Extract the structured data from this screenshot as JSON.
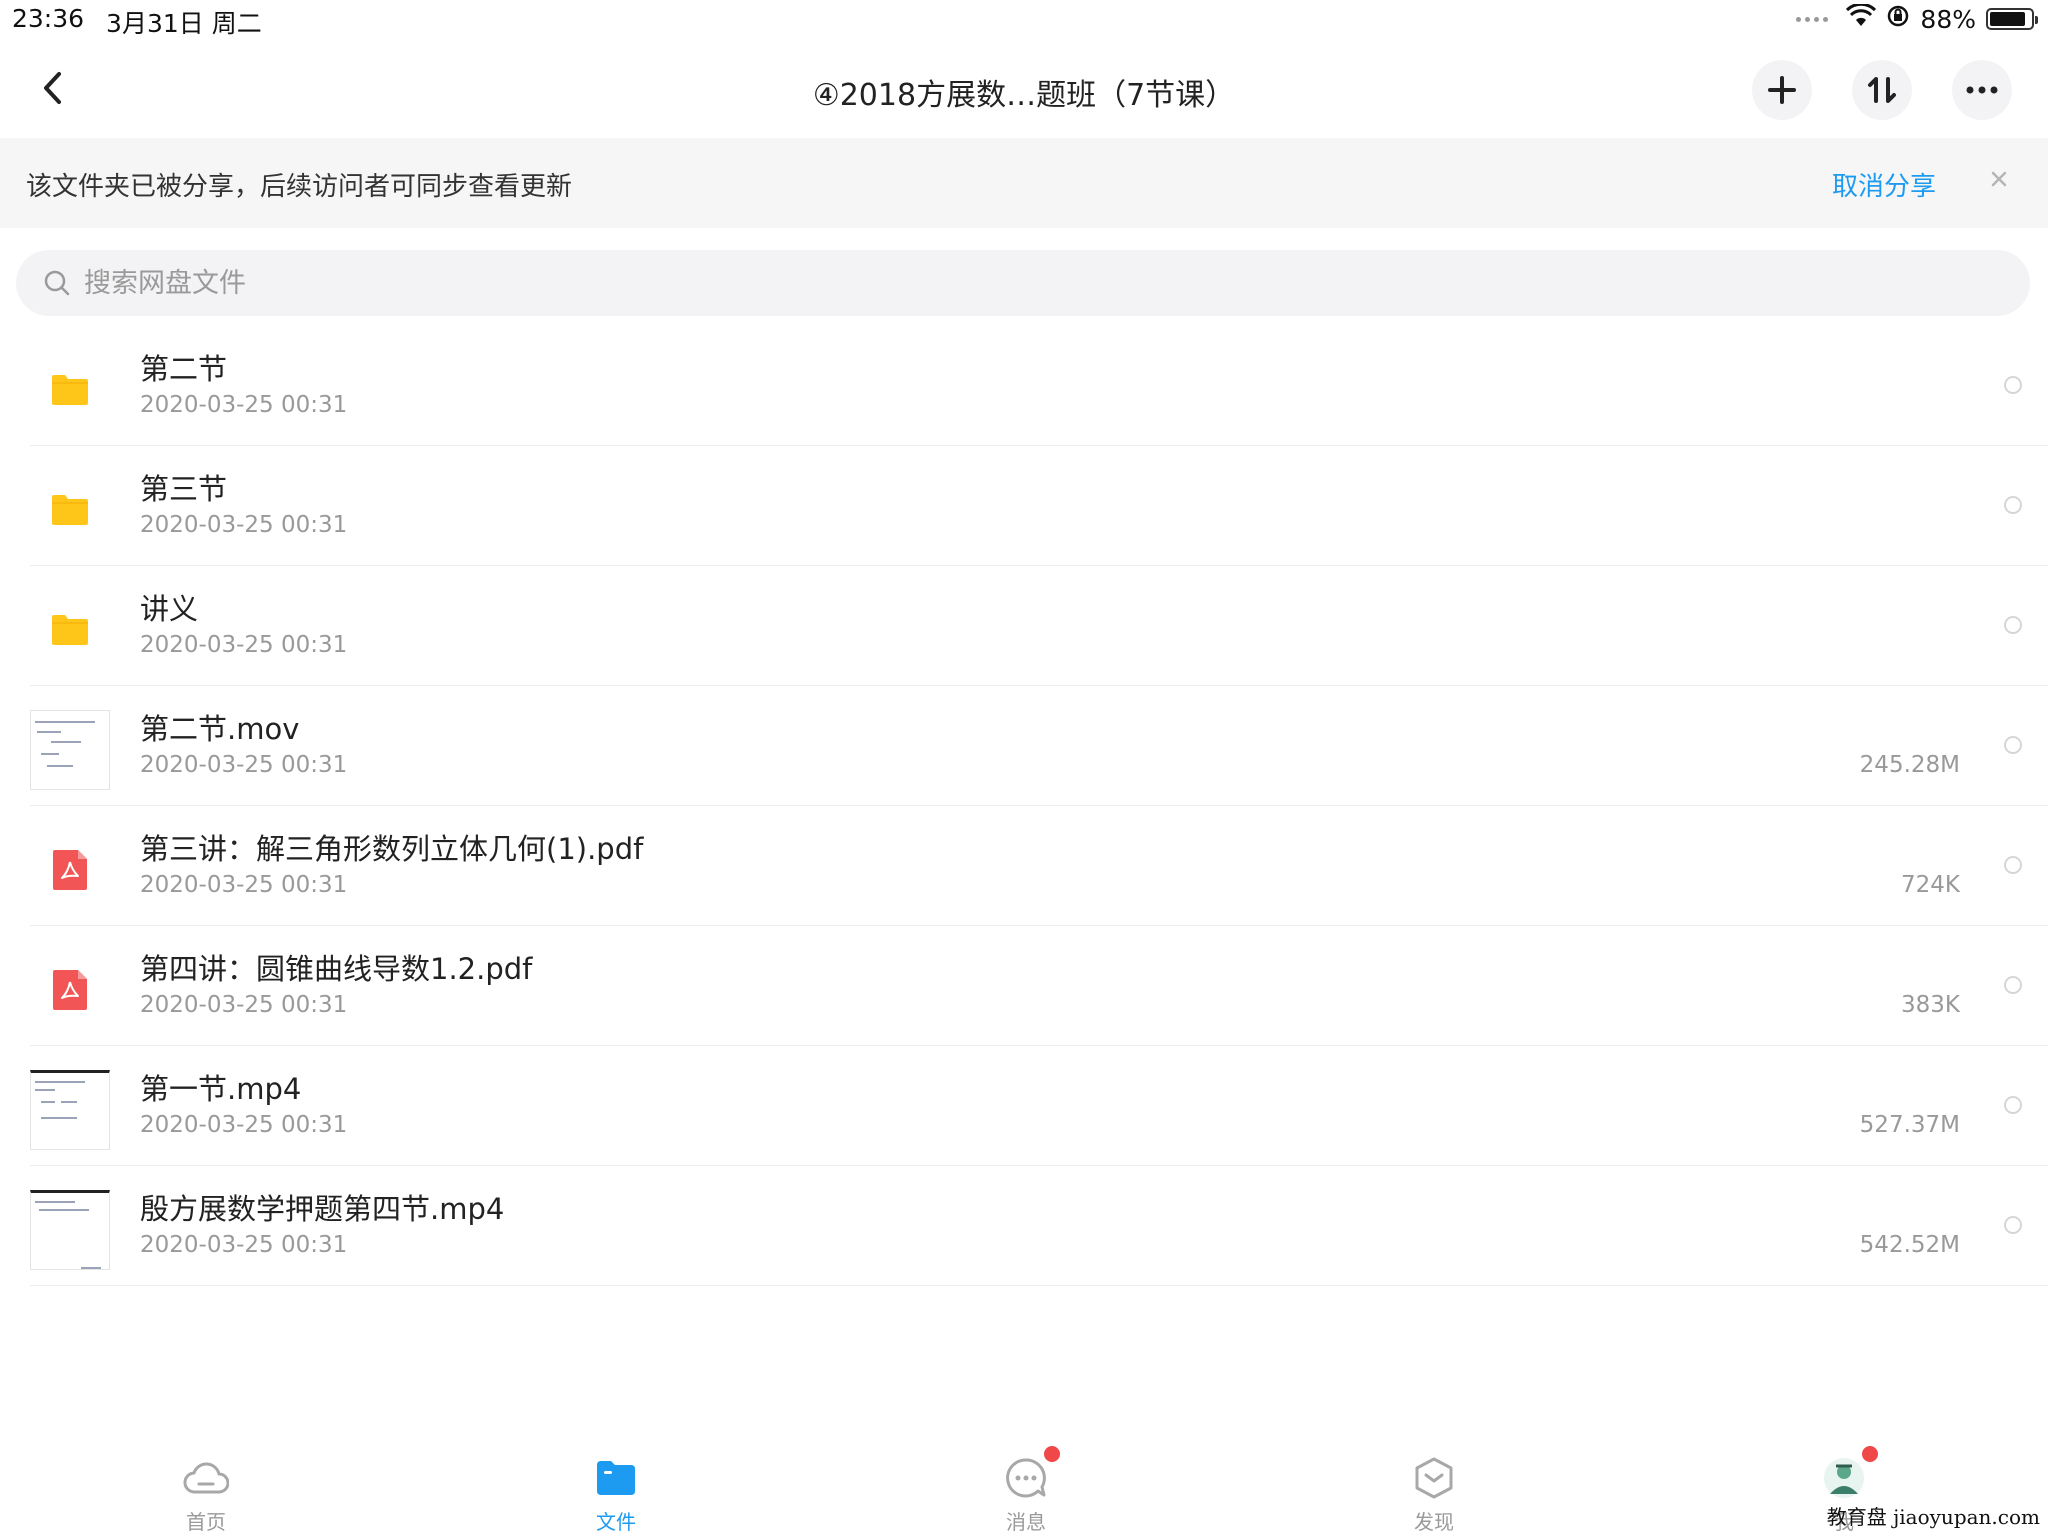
{
  "status_bar": {
    "time": "23:36",
    "date": "3月31日 周二",
    "battery": "88%",
    "battery_level": 0.88
  },
  "nav": {
    "title": "④2018方展数…题班（7节课）"
  },
  "share_banner": {
    "message": "该文件夹已被分享，后续访问者可同步查看更新",
    "cancel_label": "取消分享"
  },
  "search": {
    "placeholder": "搜索网盘文件"
  },
  "files": [
    {
      "name": "第二节",
      "date": "2020-03-25 00:31",
      "size": "",
      "type": "folder"
    },
    {
      "name": "第三节",
      "date": "2020-03-25 00:31",
      "size": "",
      "type": "folder"
    },
    {
      "name": "讲义",
      "date": "2020-03-25 00:31",
      "size": "",
      "type": "folder"
    },
    {
      "name": "第二节.mov",
      "date": "2020-03-25 00:31",
      "size": "245.28M",
      "type": "video"
    },
    {
      "name": "第三讲：解三角形数列立体几何(1).pdf",
      "date": "2020-03-25 00:31",
      "size": "724K",
      "type": "pdf"
    },
    {
      "name": "第四讲：圆锥曲线导数1.2.pdf",
      "date": "2020-03-25 00:31",
      "size": "383K",
      "type": "pdf"
    },
    {
      "name": "第一节.mp4",
      "date": "2020-03-25 00:31",
      "size": "527.37M",
      "type": "video"
    },
    {
      "name": "殷方展数学押题第四节.mp4",
      "date": "2020-03-25 00:31",
      "size": "542.52M",
      "type": "video"
    }
  ],
  "tabs": [
    {
      "label": "首页",
      "icon": "cloud-icon"
    },
    {
      "label": "文件",
      "icon": "folder-icon"
    },
    {
      "label": "消息",
      "icon": "chat-icon"
    },
    {
      "label": "发现",
      "icon": "discover-icon"
    },
    {
      "label": "我",
      "icon": "avatar-icon"
    }
  ],
  "watermark": "教育盘 jiaoyupan.com",
  "colors": {
    "accent": "#1d9bf0",
    "folder": "#ffc61a",
    "pdf": "#f25555",
    "badge": "#f04848"
  }
}
